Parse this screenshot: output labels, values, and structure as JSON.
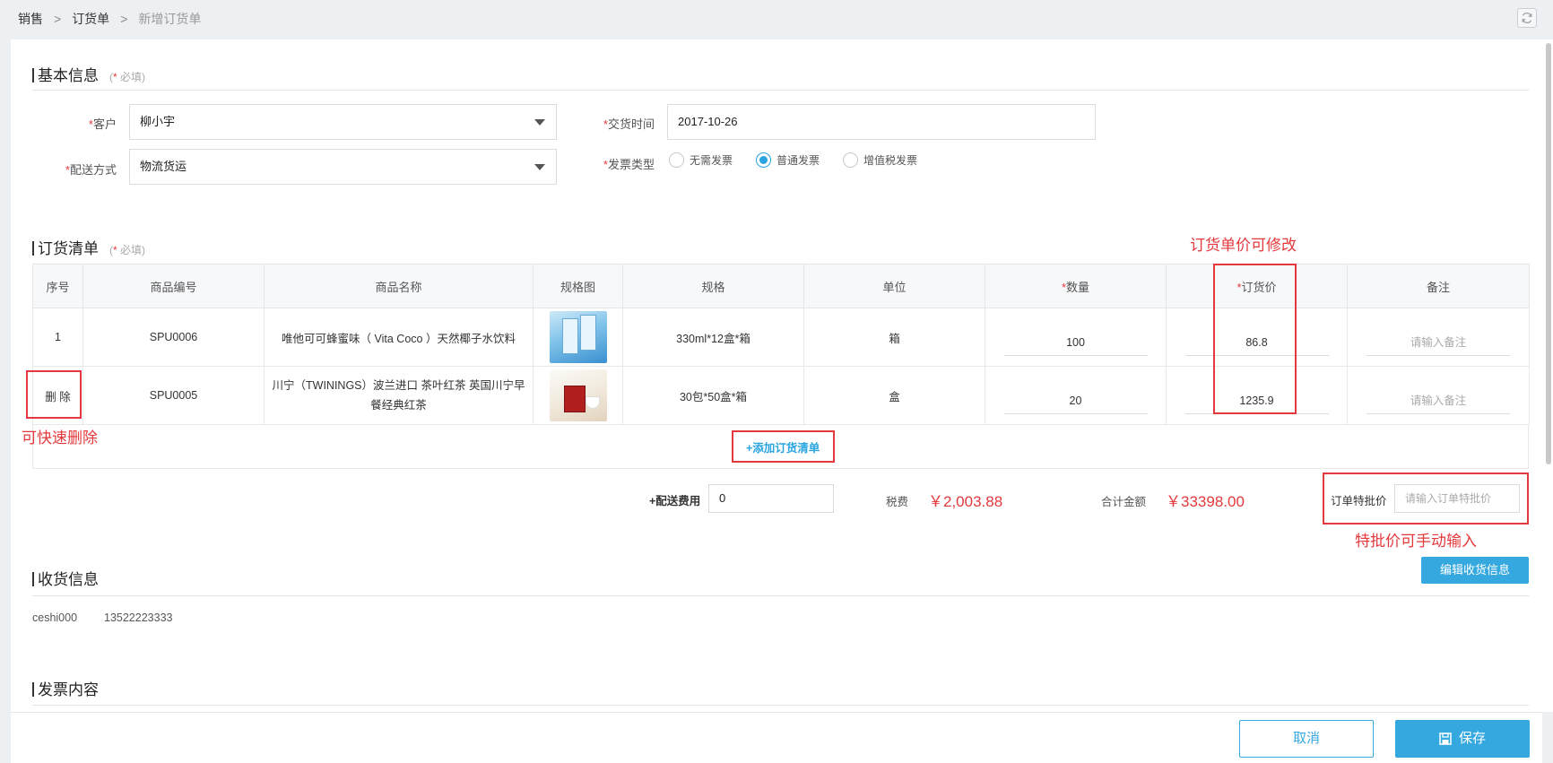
{
  "breadcrumb": [
    "销售",
    "订货单",
    "新增订货单"
  ],
  "basic_info": {
    "title": "基本信息",
    "required_note": "必填",
    "customer_label": "客户",
    "customer_value": "柳小宇",
    "delivery_method_label": "配送方式",
    "delivery_method_value": "物流货运",
    "delivery_time_label": "交货时间",
    "delivery_time_value": "2017-10-26",
    "invoice_type_label": "发票类型",
    "invoice_options": [
      "无需发票",
      "普通发票",
      "增值税发票"
    ],
    "invoice_selected": "普通发票"
  },
  "order_list": {
    "title": "订货清单",
    "required_note": "必填",
    "columns": [
      "序号",
      "商品编号",
      "商品名称",
      "规格图",
      "规格",
      "单位",
      "数量",
      "订货价",
      "备注"
    ],
    "rows": [
      {
        "index": "1",
        "code": "SPU0006",
        "name": "唯他可可蜂蜜味（ Vita Coco ）天然椰子水饮料",
        "spec": "330ml*12盒*箱",
        "unit": "箱",
        "qty": "100",
        "price": "86.8",
        "remark_placeholder": "请输入备注"
      },
      {
        "index": "删 除",
        "code": "SPU0005",
        "name": "川宁（TWININGS）波兰进口 茶叶红茶 英国川宁早餐经典红茶",
        "spec": "30包*50盒*箱",
        "unit": "盒",
        "qty": "20",
        "price": "1235.9",
        "remark_placeholder": "请输入备注"
      }
    ],
    "add_label": "+添加订货清单"
  },
  "totals": {
    "shipping_label": "+配送费用",
    "shipping_value": "0",
    "tax_label": "税费",
    "tax_value": "￥2,003.88",
    "total_label": "合计金额",
    "total_value": "￥33398.00",
    "special_price_label": "订单特批价",
    "special_price_placeholder": "请输入订单特批价"
  },
  "receiving": {
    "title": "收货信息",
    "edit_button": "编辑收货信息",
    "name": "ceshi000",
    "phone": "13522223333"
  },
  "invoice_content": {
    "title": "发票内容"
  },
  "annotations": {
    "price_editable": "订货单价可修改",
    "quick_delete": "可快速删除",
    "special_manual": "特批价可手动输入"
  },
  "footer": {
    "cancel": "取消",
    "save": "保存"
  },
  "colors": {
    "accent": "#34a8df",
    "annotation_red": "#e4393c"
  }
}
